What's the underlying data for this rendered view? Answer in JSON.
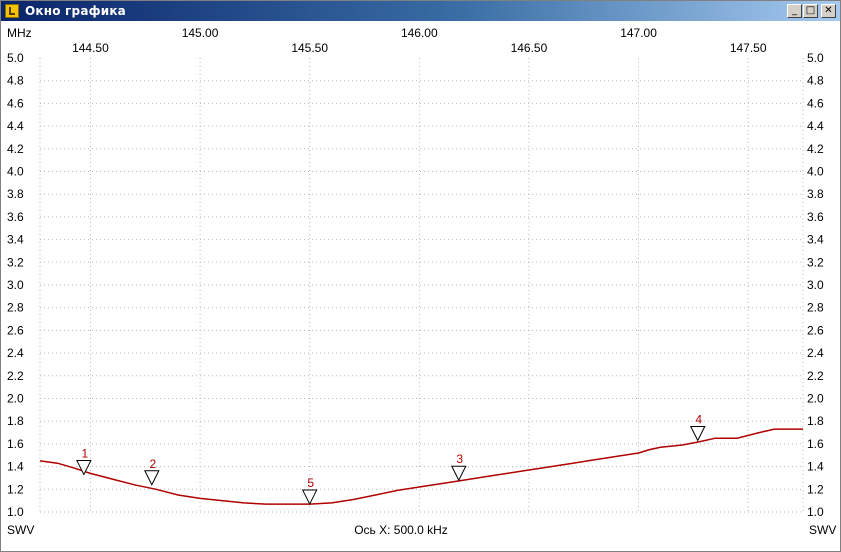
{
  "window": {
    "title": "Окно графика",
    "minimize_glyph": "_",
    "maximize_glyph": "□",
    "close_glyph": "✕"
  },
  "colors": {
    "trace": "#b00000",
    "grid": "#b8b8b8",
    "titlebar": "#0a246a"
  },
  "chart_data": {
    "type": "line",
    "xunit": "MHz",
    "ylabel_left": "SWV",
    "ylabel_right": "SWV",
    "xlabel": "Ось X: 500.0 kHz",
    "xlim": [
      144.27,
      147.75
    ],
    "ylim": [
      1.0,
      5.0
    ],
    "yticks": [
      1.0,
      1.2,
      1.4,
      1.6,
      1.8,
      2.0,
      2.2,
      2.4,
      2.6,
      2.8,
      3.0,
      3.2,
      3.4,
      3.6,
      3.8,
      4.0,
      4.2,
      4.4,
      4.6,
      4.8,
      5.0
    ],
    "ytick_labels": [
      "1.0",
      "1.2",
      "1.4",
      "1.6",
      "1.8",
      "2.0",
      "2.2",
      "2.4",
      "2.6",
      "2.8",
      "3.0",
      "3.2",
      "3.4",
      "3.6",
      "3.8",
      "4.0",
      "4.2",
      "4.4",
      "4.6",
      "4.8",
      "5.0"
    ],
    "xticks_lower": [
      144.5,
      145.5,
      146.5,
      147.5
    ],
    "xtick_labels_lower": [
      "144.50",
      "145.50",
      "146.50",
      "147.50"
    ],
    "xticks_upper": [
      145.0,
      146.0,
      147.0
    ],
    "xtick_labels_upper": [
      "145.00",
      "146.00",
      "147.00"
    ],
    "grid": true,
    "series": [
      {
        "x": [
          144.27,
          144.35,
          144.42,
          144.5,
          144.6,
          144.7,
          144.8,
          144.9,
          145.0,
          145.1,
          145.2,
          145.3,
          145.4,
          145.5,
          145.6,
          145.7,
          145.8,
          145.9,
          146.0,
          146.1,
          146.2,
          146.3,
          146.4,
          146.5,
          146.6,
          146.7,
          146.8,
          146.9,
          147.0,
          147.05,
          147.1,
          147.2,
          147.28,
          147.35,
          147.45,
          147.55,
          147.62,
          147.75
        ],
        "y": [
          1.45,
          1.43,
          1.39,
          1.34,
          1.29,
          1.24,
          1.2,
          1.15,
          1.12,
          1.1,
          1.08,
          1.07,
          1.07,
          1.07,
          1.08,
          1.11,
          1.15,
          1.19,
          1.22,
          1.25,
          1.28,
          1.31,
          1.34,
          1.37,
          1.4,
          1.43,
          1.46,
          1.49,
          1.52,
          1.55,
          1.57,
          1.59,
          1.62,
          1.65,
          1.65,
          1.7,
          1.73,
          1.73
        ]
      }
    ],
    "markers": [
      {
        "label": "1",
        "x": 144.47,
        "y": 1.33
      },
      {
        "label": "2",
        "x": 144.78,
        "y": 1.24
      },
      {
        "label": "5",
        "x": 145.5,
        "y": 1.07
      },
      {
        "label": "3",
        "x": 146.18,
        "y": 1.28
      },
      {
        "label": "4",
        "x": 147.27,
        "y": 1.63
      }
    ]
  }
}
